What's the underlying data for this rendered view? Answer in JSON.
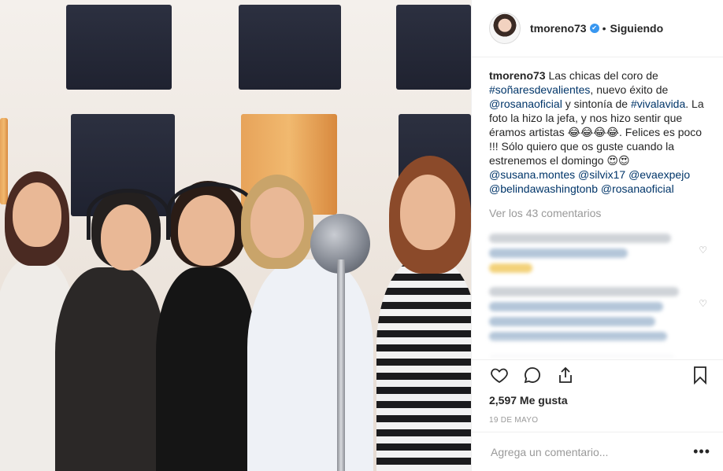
{
  "header": {
    "username": "tmoreno73",
    "verified_glyph": "✔",
    "separator": "•",
    "follow_label": "Siguiendo"
  },
  "caption": {
    "username": "tmoreno73",
    "text_1": "Las chicas del coro de",
    "hashtag_1": "#soñaresdevalientes",
    "text_2": ", nuevo éxito de",
    "mention_1": "@rosanaoficial",
    "text_3": "y sintonía de",
    "hashtag_2": "#vivalavida",
    "text_4": ". La foto la hizo la jefa, y nos hizo sentir que éramos artistas 😂😂😂😂. Felices es poco !!! Sólo quiero que os guste cuando la estrenemos el domingo 😍😍",
    "mention_2": "@susana.montes",
    "mention_3": "@silvix17",
    "mention_4": "@evaexpejo",
    "mention_5": "@belindawashingtonb",
    "mention_6": "@rosanaoficial"
  },
  "view_all_label": "Ver los 43 comentarios",
  "icons": {
    "like": "heart-icon",
    "comment": "comment-icon",
    "share": "share-icon",
    "save": "bookmark-icon",
    "comment_like": "heart-small-icon"
  },
  "likes_label": "2,597 Me gusta",
  "date_label": "19 DE MAYO",
  "add_comment": {
    "placeholder": "Agrega un comentario...",
    "more_label": "•••"
  },
  "colors": {
    "link": "#003569",
    "muted": "#999999",
    "verified": "#3897f0",
    "border": "#efefef"
  }
}
